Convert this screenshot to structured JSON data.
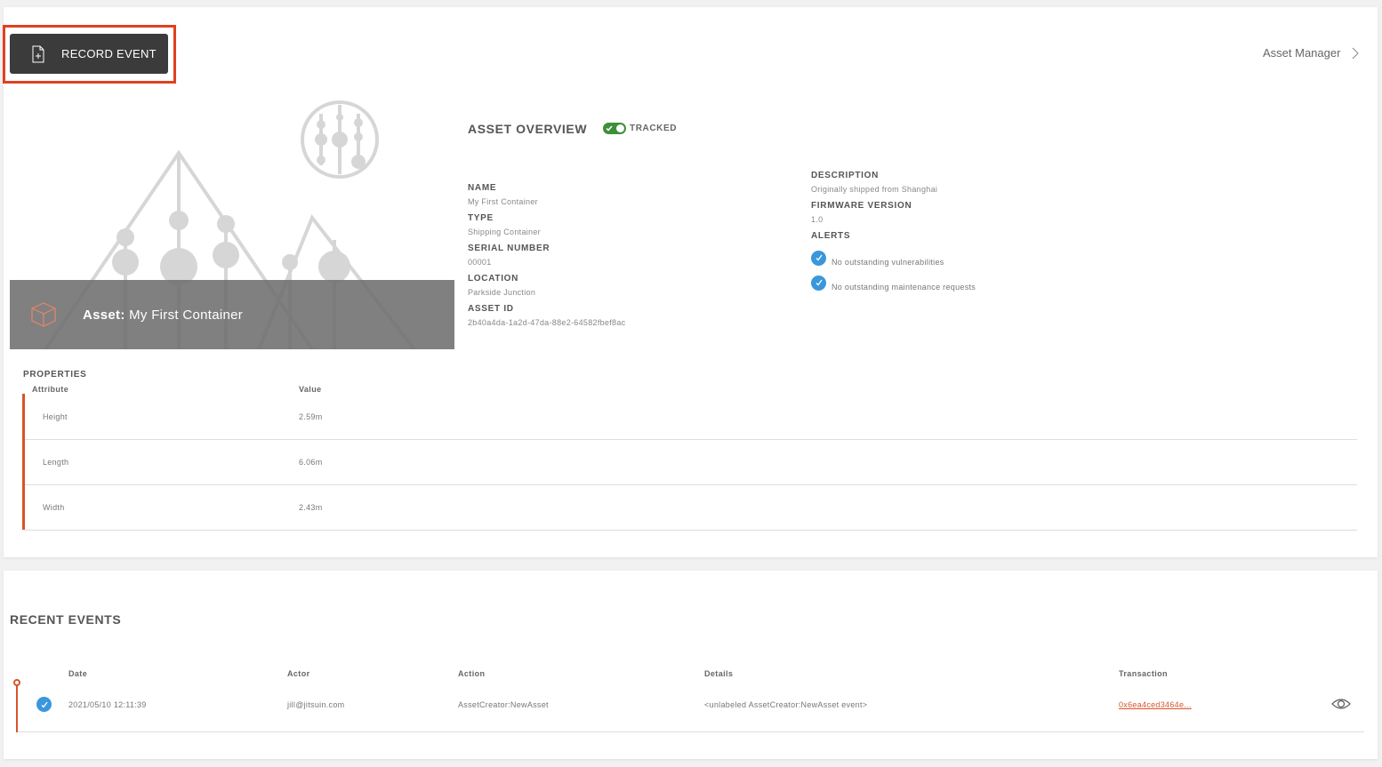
{
  "header": {
    "record_button_label": "RECORD EVENT",
    "breadcrumb": "Asset Manager"
  },
  "hero": {
    "asset_prefix": "Asset:",
    "asset_name": "My First Container"
  },
  "overview": {
    "title": "ASSET OVERVIEW",
    "tracked_label": "TRACKED",
    "fields": {
      "name_label": "NAME",
      "name_value": "My First Container",
      "type_label": "TYPE",
      "type_value": "Shipping Container",
      "serial_label": "SERIAL NUMBER",
      "serial_value": "00001",
      "location_label": "LOCATION",
      "location_value": "Parkside Junction",
      "asset_id_label": "ASSET ID",
      "asset_id_value": "2b40a4da-1a2d-47da-88e2-64582fbef8ac",
      "description_label": "DESCRIPTION",
      "description_value": "Originally shipped from Shanghai",
      "firmware_label": "FIRMWARE VERSION",
      "firmware_value": "1.0",
      "alerts_label": "ALERTS"
    },
    "alerts": [
      "No outstanding vulnerabilities",
      "No outstanding maintenance requests"
    ]
  },
  "properties": {
    "title": "PROPERTIES",
    "col_attribute": "Attribute",
    "col_value": "Value",
    "rows": [
      {
        "attribute": "Height",
        "value": "2.59m"
      },
      {
        "attribute": "Length",
        "value": "6.06m"
      },
      {
        "attribute": "Width",
        "value": "2.43m"
      }
    ]
  },
  "events": {
    "title": "RECENT EVENTS",
    "columns": [
      "Date",
      "Actor",
      "Action",
      "Details",
      "Transaction"
    ],
    "rows": [
      {
        "date": "2021/05/10 12:11:39",
        "actor": "jill@jitsuin.com",
        "action": "AssetCreator:NewAsset",
        "details": "<unlabeled AssetCreator:NewAsset event>",
        "transaction": "0x6ea4ced3464e..."
      }
    ]
  },
  "colors": {
    "accent": "#d9532a",
    "button_dark": "#3b3b3b",
    "toggle_on": "#3e8e3a",
    "check_blue": "#3a97dc",
    "highlight": "#e0401f"
  }
}
